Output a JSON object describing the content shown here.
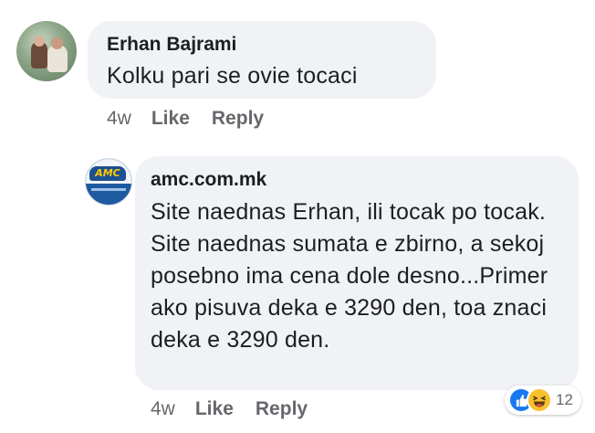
{
  "comments": [
    {
      "author": "Erhan Bajrami",
      "text": "Kolku pari se ovie tocaci",
      "time": "4w",
      "like_label": "Like",
      "reply_label": "Reply"
    },
    {
      "author": "amc.com.mk",
      "avatar_text": "AMC",
      "text": "Site naednas Erhan, ili tocak po tocak. Site naednas sumata e zbirno, a sekoj posebno ima cena dole desno...Primer ako pisuva deka e 3290 den, toa znaci deka e 3290 den.",
      "time": "4w",
      "like_label": "Like",
      "reply_label": "Reply",
      "reaction_count": "12",
      "reactions": [
        "like-icon",
        "haha-icon"
      ]
    }
  ],
  "colors": {
    "bubble": "#f0f2f5",
    "text": "#1c1e21",
    "meta": "#65676b",
    "like": "#1877f2",
    "haha": "#f7c02d"
  }
}
